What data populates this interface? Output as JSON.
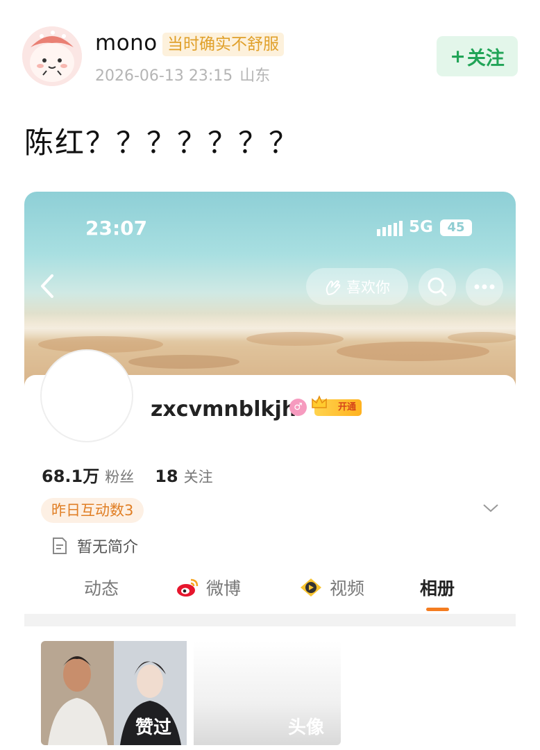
{
  "post": {
    "username": "mono",
    "tag": "当时确实不舒服",
    "date": "2026-06-13 23:15",
    "location": "山东",
    "follow_label": "关注",
    "text": "陈红？？？？？？？"
  },
  "screenshot": {
    "status_bar": {
      "time": "23:07",
      "network": "5G",
      "battery": "45"
    },
    "header": {
      "like_label": "喜欢你"
    },
    "profile": {
      "name": "zxcvmnblkjh",
      "vip_label": "开通",
      "followers_count": "68.1万",
      "followers_label": "粉丝",
      "following_count": "18",
      "following_label": "关注",
      "interaction_badge": "昨日互动数3",
      "bio": "暂无简介"
    },
    "tabs": [
      {
        "label": "动态",
        "icon": "none"
      },
      {
        "label": "微博",
        "icon": "weibo-icon"
      },
      {
        "label": "视频",
        "icon": "video-icon"
      },
      {
        "label": "相册",
        "icon": "none",
        "active": true
      }
    ],
    "album": {
      "photo1_label": "赞过",
      "photo2_label": "头像"
    }
  },
  "colors": {
    "follow_green": "#21a457",
    "tag_orange": "#e0a02a",
    "tab_accent": "#f47c20"
  }
}
